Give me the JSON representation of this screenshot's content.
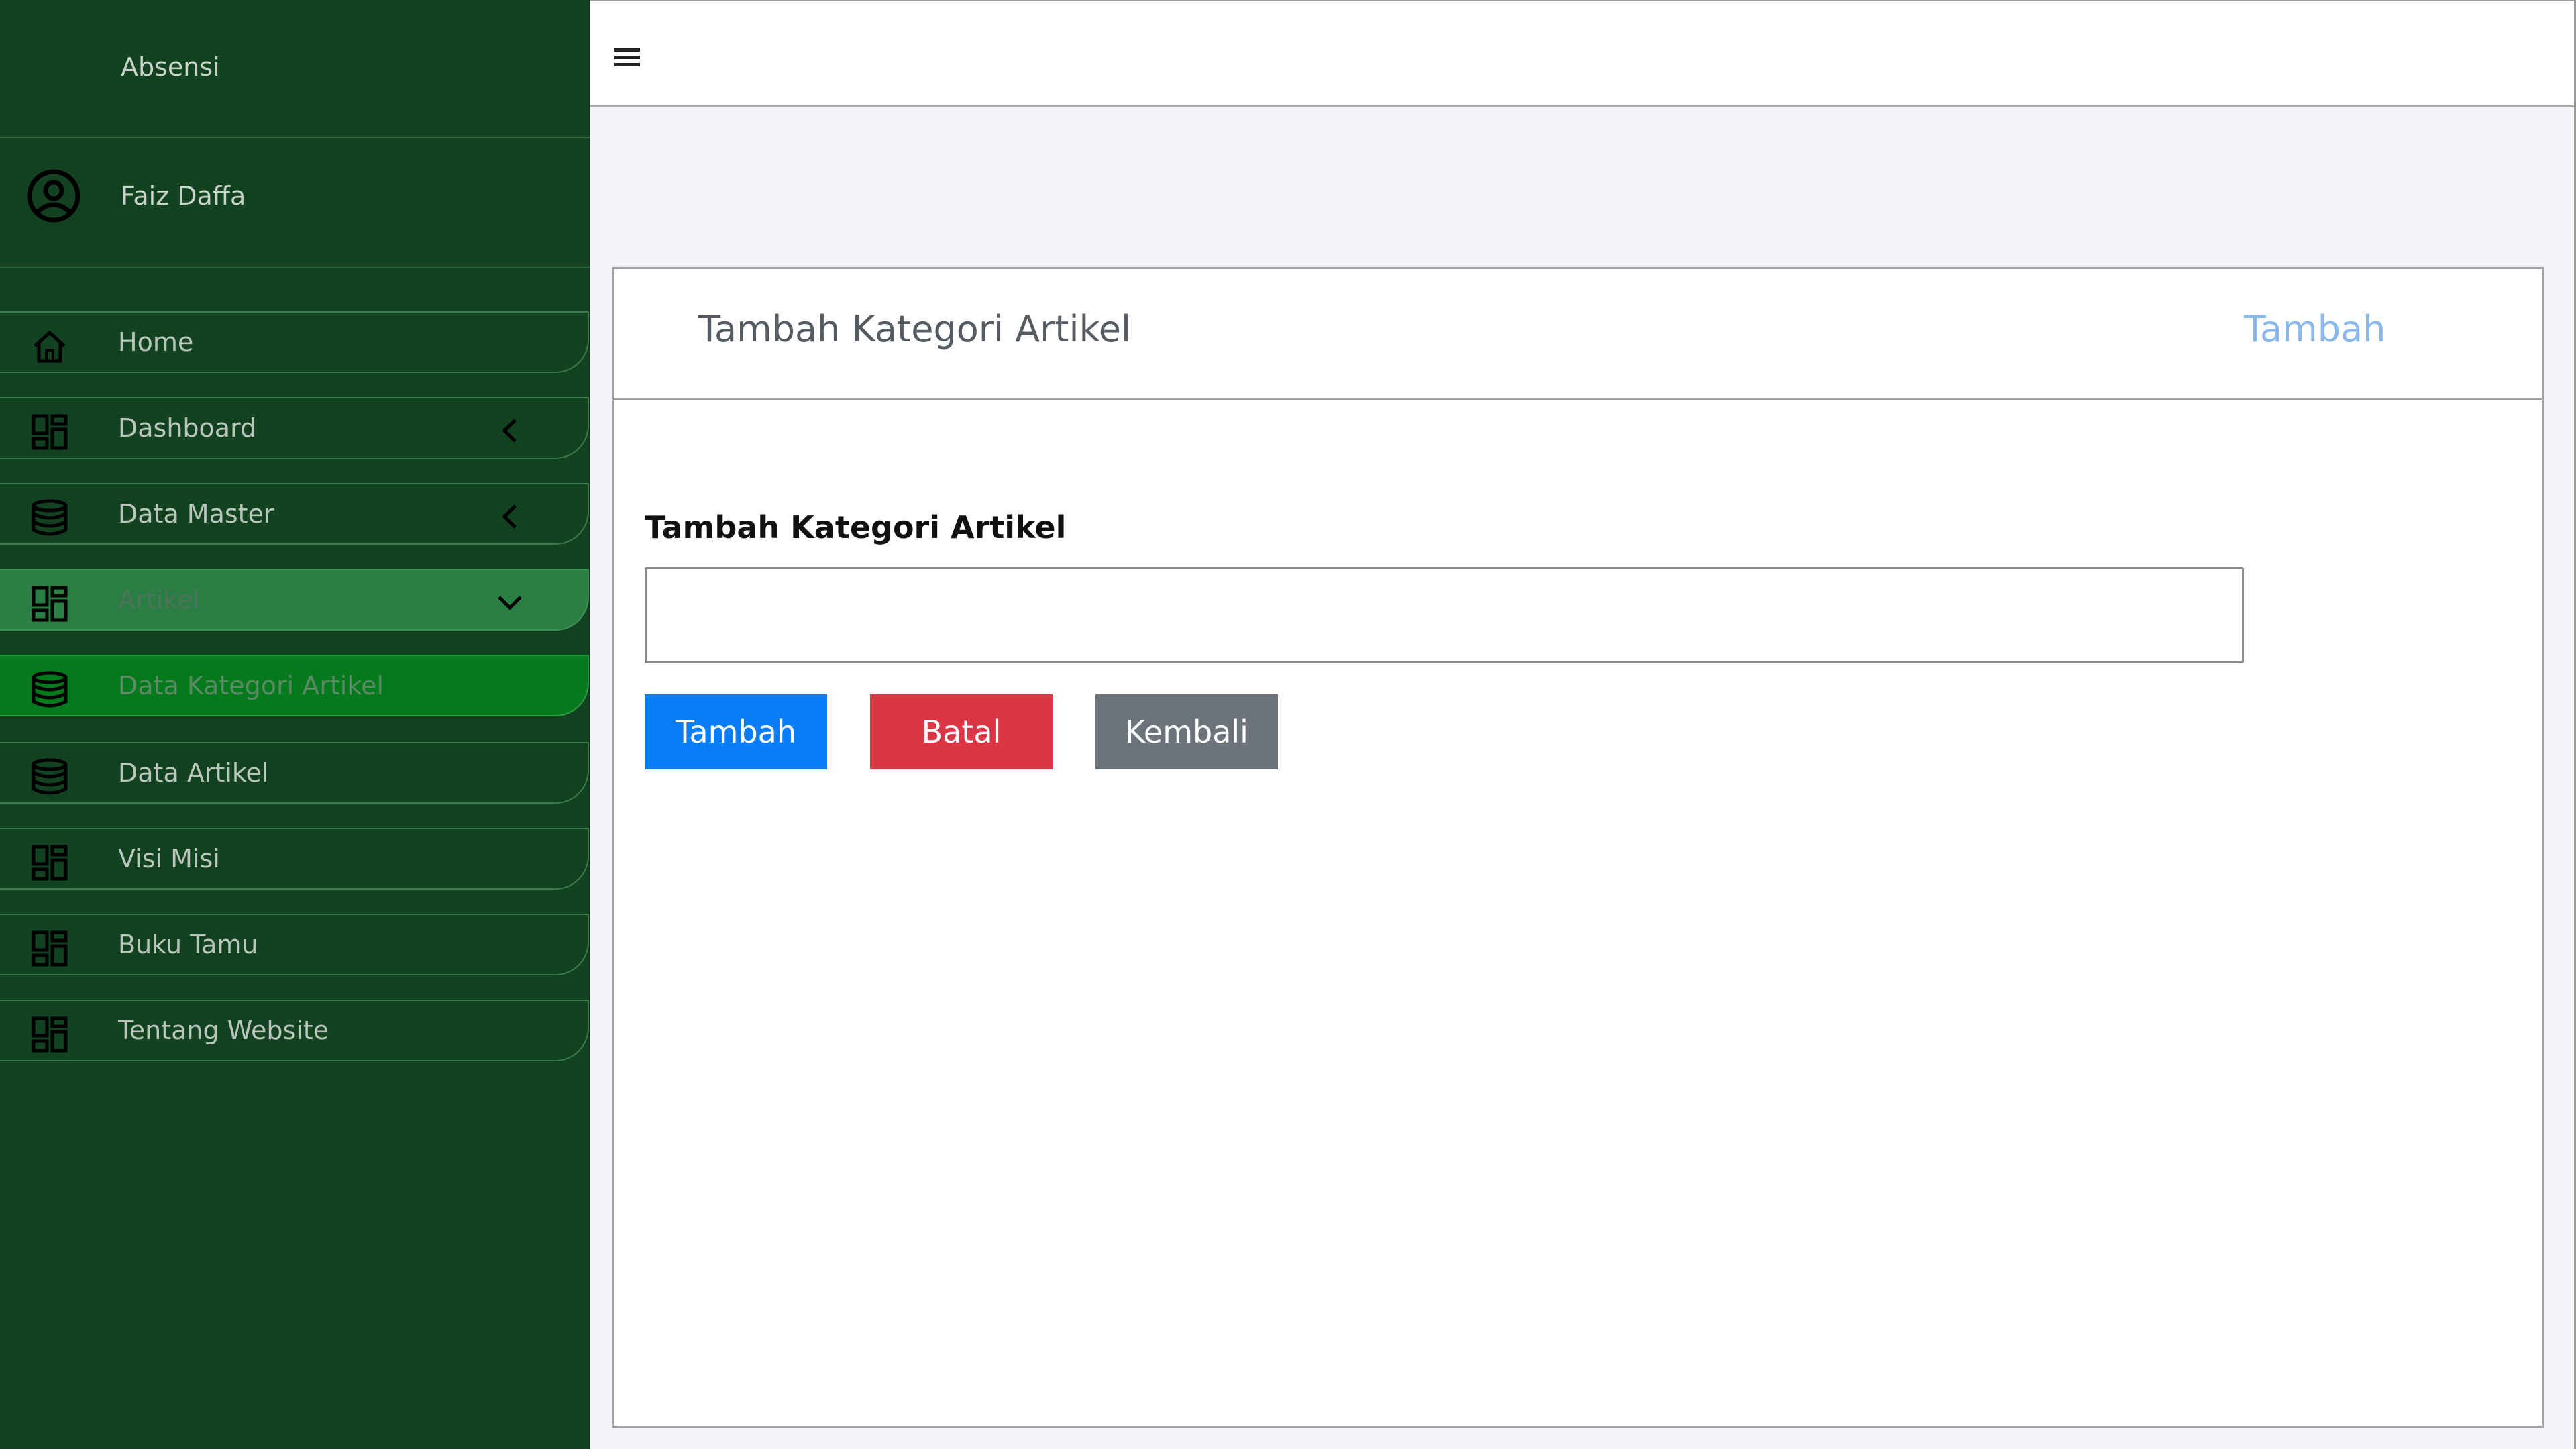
{
  "sidebar": {
    "brand": "Absensi",
    "user": {
      "name": "Faiz Daffa",
      "icon": "user-circle-icon"
    },
    "items": [
      {
        "label": "Home",
        "icon": "home-icon"
      },
      {
        "label": "Dashboard",
        "icon": "grid-icon",
        "arrow": "chevron-left-icon"
      },
      {
        "label": "Data Master",
        "icon": "database-icon",
        "arrow": "chevron-left-icon"
      },
      {
        "label": "Artikel",
        "icon": "grid-icon",
        "arrow": "chevron-down-icon",
        "state": "open"
      },
      {
        "label": "Data Kategori Artikel",
        "icon": "database-icon",
        "state": "active"
      },
      {
        "label": "Data Artikel",
        "icon": "database-icon"
      },
      {
        "label": "Visi Misi",
        "icon": "grid-icon"
      },
      {
        "label": "Buku Tamu",
        "icon": "grid-icon"
      },
      {
        "label": "Tentang Website",
        "icon": "grid-icon"
      }
    ]
  },
  "topbar": {
    "menu_icon": "hamburger-icon"
  },
  "card": {
    "title": "Tambah Kategori Artikel",
    "header_link": "Tambah",
    "form": {
      "label": "Tambah Kategori Artikel",
      "input_value": "",
      "input_placeholder": "",
      "buttons": {
        "submit": "Tambah",
        "cancel": "Batal",
        "back": "Kembali"
      }
    }
  },
  "colors": {
    "sidebar_bg": "#12421f",
    "sidebar_open": "#2a7e44",
    "sidebar_active": "#047a1c",
    "primary": "#0a7df9",
    "danger": "#dc3545",
    "secondary": "#6c737a",
    "link": "#8ab8ea"
  }
}
